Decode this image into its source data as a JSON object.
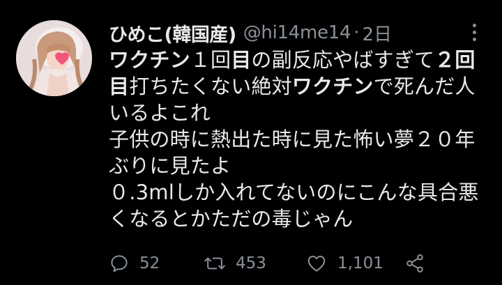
{
  "tweet": {
    "author": {
      "display_name": "ひめこ(韓国産)",
      "handle": "@hi14me14",
      "separator": "·",
      "time": "2日"
    },
    "body_lines": [
      [
        {
          "text": "ワクチン",
          "bold": true
        },
        {
          "text": "１回",
          "bold": false
        },
        {
          "text": "目",
          "bold": true
        },
        {
          "text": "の副反応やばすぎて",
          "bold": false
        },
        {
          "text": "２回",
          "bold": true
        }
      ],
      [
        {
          "text": "目",
          "bold": true
        },
        {
          "text": "打ちたくない絶対",
          "bold": false
        },
        {
          "text": "ワクチン",
          "bold": true
        },
        {
          "text": "で死んだ人",
          "bold": false
        }
      ],
      [
        {
          "text": "いるよこれ",
          "bold": false
        }
      ],
      [
        {
          "text": "子供の時に熱出た時に見た怖い夢２０年",
          "bold": false
        }
      ],
      [
        {
          "text": "ぶりに見たよ",
          "bold": false
        }
      ],
      [
        {
          "text": "０.3mlしか入れてないのにこんな具合悪",
          "bold": false
        }
      ],
      [
        {
          "text": "くなるとかただの毒じゃん",
          "bold": false
        }
      ]
    ],
    "actions": {
      "reply": {
        "icon": "reply-icon",
        "count": "52"
      },
      "retweet": {
        "icon": "retweet-icon",
        "count": "453"
      },
      "like": {
        "icon": "heart-icon",
        "count": "1,101"
      },
      "share": {
        "icon": "share-icon"
      }
    },
    "colors": {
      "background": "#000000",
      "text": "#e7e9ea",
      "secondary": "#8b9299"
    }
  }
}
